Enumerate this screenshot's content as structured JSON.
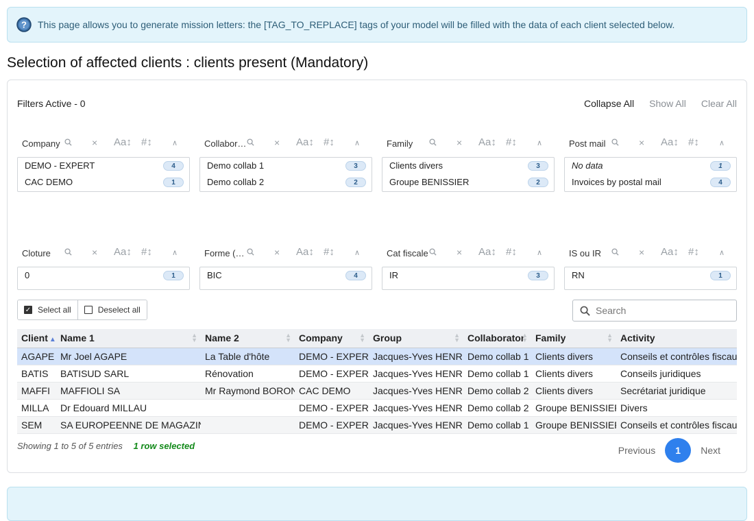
{
  "info_top": {
    "text": "This page allows you to generate mission letters: the [TAG_TO_REPLACE] tags of your model will be filled with the data of each client selected below."
  },
  "section_title": "Selection of affected clients : clients present (Mandatory)",
  "filters": {
    "active_label": "Filters Active - 0",
    "collapse_all": "Collapse All",
    "show_all": "Show All",
    "clear_all": "Clear All",
    "panes": [
      {
        "title": "Company",
        "items": [
          {
            "label": "DEMO - EXPERT",
            "count": "4"
          },
          {
            "label": "CAC DEMO",
            "count": "1"
          }
        ]
      },
      {
        "title": "Collaborator",
        "items": [
          {
            "label": "Demo collab 1",
            "count": "3"
          },
          {
            "label": "Demo collab 2",
            "count": "2"
          }
        ]
      },
      {
        "title": "Family",
        "items": [
          {
            "label": "Clients divers",
            "count": "3"
          },
          {
            "label": "Groupe BENISSIER",
            "count": "2"
          }
        ]
      },
      {
        "title": "Post mail",
        "items": [
          {
            "label": "No data",
            "count": "1"
          },
          {
            "label": "Invoices by postal mail",
            "count": "4"
          }
        ]
      },
      {
        "title": "Cloture",
        "items": [
          {
            "label": "0",
            "count": "1"
          }
        ]
      },
      {
        "title": "Forme (sociale)",
        "items": [
          {
            "label": "BIC",
            "count": "4"
          }
        ]
      },
      {
        "title": "Cat fiscale",
        "items": [
          {
            "label": "IR",
            "count": "3"
          }
        ]
      },
      {
        "title": "IS ou IR",
        "items": [
          {
            "label": "RN",
            "count": "1"
          }
        ]
      }
    ]
  },
  "selection": {
    "select_all": "Select all",
    "deselect_all": "Deselect all"
  },
  "search": {
    "placeholder": "Search"
  },
  "table": {
    "columns": [
      "Client",
      "Name 1",
      "Name 2",
      "Company",
      "Group",
      "Collaborator",
      "Family",
      "Activity"
    ],
    "rows": [
      [
        "AGAPE",
        "Mr Joel AGAPE",
        "La Table d'hôte",
        "DEMO - EXPERT",
        "Jacques-Yves HENRI",
        "Demo collab 1",
        "Clients divers",
        "Conseils et contrôles fiscaux"
      ],
      [
        "BATIS",
        "BATISUD SARL",
        "Rénovation",
        "DEMO - EXPERT",
        "Jacques-Yves HENRI",
        "Demo collab 1",
        "Clients divers",
        "Conseils juridiques"
      ],
      [
        "MAFFI",
        "MAFFIOLI SA",
        "Mr Raymond BORON",
        "CAC DEMO",
        "Jacques-Yves HENRI",
        "Demo collab 2",
        "Clients divers",
        "Secrétariat juridique"
      ],
      [
        "MILLA",
        "Dr Edouard MILLAU",
        "",
        "DEMO - EXPERT",
        "Jacques-Yves HENRI",
        "Demo collab 2",
        "Groupe BENISSIER",
        "Divers"
      ],
      [
        "SEM",
        "SA EUROPEENNE DE MAGAZINES",
        "",
        "DEMO - EXPERT",
        "Jacques-Yves HENRI",
        "Demo collab 1",
        "Groupe BENISSIER",
        "Conseils et contrôles fiscaux"
      ]
    ],
    "info": "Showing 1 to 5 of 5 entries",
    "selected_info": "1 row selected"
  },
  "pagination": {
    "previous": "Previous",
    "current": "1",
    "next": "Next"
  },
  "colors": {
    "accent": "#2f80ed",
    "selected_row": "#d4e3fa",
    "info_bg": "#e3f4fb",
    "selected_text": "#138a1a"
  }
}
